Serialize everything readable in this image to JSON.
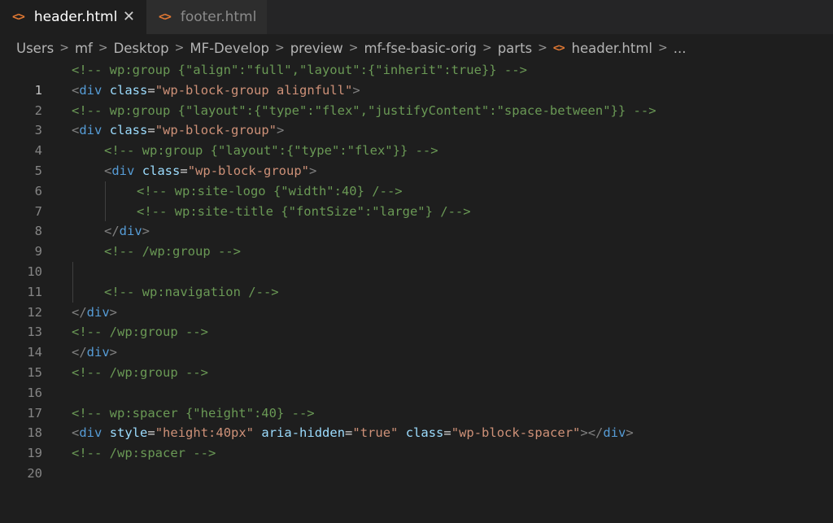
{
  "tabs": [
    {
      "label": "header.html",
      "active": true
    },
    {
      "label": "footer.html",
      "active": false
    }
  ],
  "tab_close_glyph": "✕",
  "file_icon_glyph": "<>",
  "breadcrumb": [
    "Users",
    "mf",
    "Desktop",
    "MF-Develop",
    "preview",
    "mf-fse-basic-orig",
    "parts",
    "header.html",
    "..."
  ],
  "editor": {
    "line_numbers": [
      "1",
      "2",
      "3",
      "4",
      "5",
      "6",
      "7",
      "8",
      "9",
      "10",
      "11",
      "12",
      "13",
      "14",
      "15",
      "16",
      "17",
      "18",
      "19",
      "20"
    ],
    "current_line": "1",
    "lines": {
      "l1": "<!-- wp:group {\"align\":\"full\",\"layout\":{\"inherit\":true}} -->",
      "l2_open": "<",
      "l2_tag": "div",
      "l2_attr": "class",
      "l2_eq": "=",
      "l2_str": "\"wp-block-group alignfull\"",
      "l2_close": ">",
      "l3": "<!-- wp:group {\"layout\":{\"type\":\"flex\",\"justifyContent\":\"space-between\"}} -->",
      "l4_open": "<",
      "l4_tag": "div",
      "l4_attr": "class",
      "l4_eq": "=",
      "l4_str": "\"wp-block-group\"",
      "l4_close": ">",
      "l5": "<!-- wp:group {\"layout\":{\"type\":\"flex\"}} -->",
      "l6_open": "<",
      "l6_tag": "div",
      "l6_attr": "class",
      "l6_eq": "=",
      "l6_str": "\"wp-block-group\"",
      "l6_close": ">",
      "l7": "<!-- wp:site-logo {\"width\":40} /-->",
      "l8": "<!-- wp:site-title {\"fontSize\":\"large\"} /-->",
      "l9_open": "</",
      "l9_tag": "div",
      "l9_close": ">",
      "l10": "<!-- /wp:group -->",
      "l12": "<!-- wp:navigation /-->",
      "l13_open": "</",
      "l13_tag": "div",
      "l13_close": ">",
      "l14": "<!-- /wp:group -->",
      "l15_open": "</",
      "l15_tag": "div",
      "l15_close": ">",
      "l16": "<!-- /wp:group -->",
      "l18": "<!-- wp:spacer {\"height\":40} -->",
      "l19_open": "<",
      "l19_tag": "div",
      "l19_attr1": "style",
      "l19_eq1": "=",
      "l19_str1": "\"height:40px\"",
      "l19_attr2": "aria-hidden",
      "l19_eq2": "=",
      "l19_str2": "\"true\"",
      "l19_attr3": "class",
      "l19_eq3": "=",
      "l19_str3": "\"wp-block-spacer\"",
      "l19_mid": "></",
      "l19_tag2": "div",
      "l19_close": ">",
      "l20": "<!-- /wp:spacer -->"
    }
  },
  "colors": {
    "background": "#1e1e1e",
    "comment": "#6a9955",
    "tag": "#569cd6",
    "attribute": "#9cdcfe",
    "string": "#ce9178",
    "file_icon": "#e37933"
  }
}
